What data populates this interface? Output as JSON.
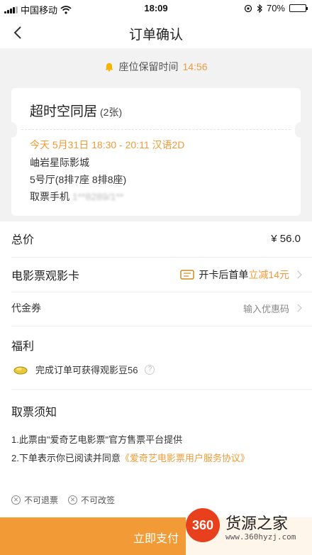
{
  "status": {
    "carrier": "中国移动",
    "time": "18:09",
    "battery": "70%",
    "battery_level": 0.7
  },
  "nav": {
    "title": "订单确认"
  },
  "hold": {
    "label": "座位保留时间",
    "timer": "14:56"
  },
  "ticket": {
    "movie": "超时空同居",
    "count": "(2张)",
    "showtime": "今天 5月31日 18:30 - 20:11 汉语2D",
    "cinema": "岫岩星际影城",
    "hall": "5号厅(8排7座 8排8座)",
    "phone_label": "取票手机",
    "phone_masked": "1**8289/1**"
  },
  "total": {
    "label": "总价",
    "value": "¥ 56.0"
  },
  "card": {
    "label": "电影票观影卡",
    "promo_prefix": "开卡后首单",
    "promo_highlight": "立减14元"
  },
  "coupon": {
    "label": "代金券",
    "placeholder": "输入优惠码"
  },
  "benefit": {
    "title": "福利",
    "text": "完成订单可获得观影豆56",
    "help": "?"
  },
  "notice": {
    "title": "取票须知",
    "line1": "1.此票由\"爱奇艺电影票\"官方售票平台提供",
    "line2_prefix": "2.下单表示你已阅读并同意",
    "line2_link": "《爱奇艺电影票用户服务协议》"
  },
  "flags": {
    "no_refund": "不可退票",
    "no_change": "不可改签"
  },
  "pay": {
    "label": "立即支付"
  },
  "watermark": {
    "badge": "360",
    "name": "货源之家",
    "url": "www.360hyzj.com"
  },
  "colors": {
    "accent": "#f29a36",
    "background": "#f2f2f2"
  },
  "icons": [
    "back-arrow-icon",
    "bell-icon",
    "ticket-card-icon",
    "bean-icon",
    "help-icon",
    "cross-circle-icon",
    "wifi-icon",
    "bluetooth-icon",
    "battery-icon"
  ]
}
